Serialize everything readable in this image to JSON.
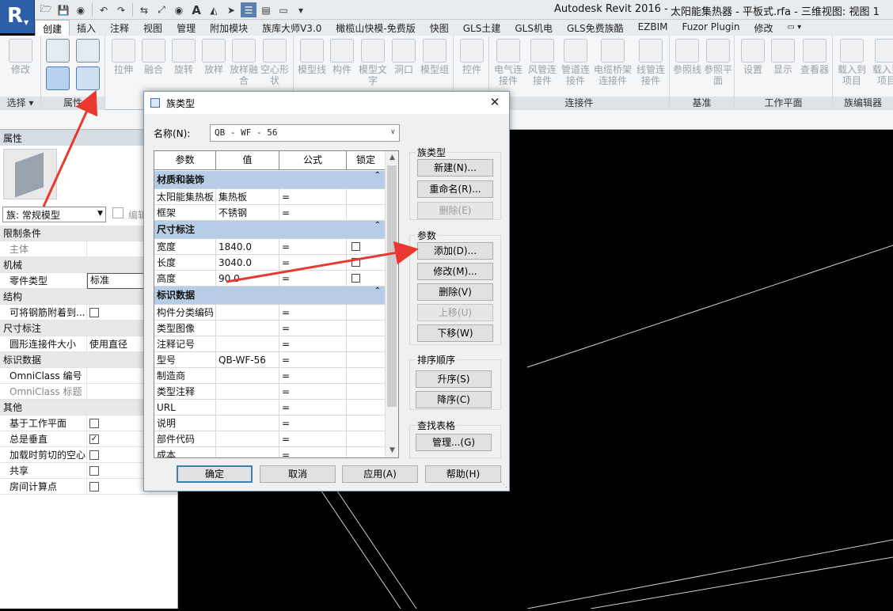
{
  "app": {
    "logo_letter": "R",
    "title": "Autodesk Revit 2016 -",
    "document": "太阳能集热器 - 平板式.rfa - 三维视图: 视图 1"
  },
  "ribbon_tabs": [
    "创建",
    "插入",
    "注释",
    "视图",
    "管理",
    "附加模块",
    "族库大师V3.0",
    "橄榄山快模-免费版",
    "快图",
    "GLS土建",
    "GLS机电",
    "GLS免费族酷",
    "EZBIM",
    "Fuzor Plugin",
    "修改"
  ],
  "ribbon": {
    "select": {
      "title": "选择",
      "modify": "修改"
    },
    "properties": {
      "title": "属性"
    },
    "forms": [
      "拉伸",
      "融合",
      "旋转",
      "放样",
      "放样融合",
      "空心形状"
    ],
    "model": [
      "模型线",
      "构件",
      "模型文字",
      "洞口",
      "模型组"
    ],
    "control": [
      "控件"
    ],
    "connectors": {
      "title": "连接件",
      "items": [
        "电气连接件",
        "风管连接件",
        "管道连接件",
        "电缆桥架连接件",
        "线管连接件"
      ]
    },
    "datum": {
      "title": "基准",
      "items": [
        "参照线",
        "参照平面"
      ]
    },
    "workplane": {
      "title": "工作平面",
      "items": [
        "设置",
        "显示",
        "查看器"
      ]
    },
    "family_editor": {
      "title": "族编辑器",
      "items": [
        "载入到项目",
        "载入到项目"
      ]
    }
  },
  "properties": {
    "header": "属性",
    "family_select": "族: 常规模型",
    "edit_type": "编辑",
    "rows": [
      {
        "type": "group",
        "label": "限制条件"
      },
      {
        "type": "prop",
        "name": "主体",
        "value": "",
        "dim": true
      },
      {
        "type": "group",
        "label": "机械"
      },
      {
        "type": "prop",
        "name": "零件类型",
        "value": "标准",
        "boxed": true
      },
      {
        "type": "group",
        "label": "结构"
      },
      {
        "type": "prop",
        "name": "可将钢筋附着到...",
        "check": false
      },
      {
        "type": "group",
        "label": "尺寸标注"
      },
      {
        "type": "prop",
        "name": "圆形连接件大小",
        "value": "使用直径"
      },
      {
        "type": "group",
        "label": "标识数据"
      },
      {
        "type": "prop",
        "name": "OmniClass 编号",
        "value": ""
      },
      {
        "type": "prop",
        "name": "OmniClass 标题",
        "value": "",
        "dim": true
      },
      {
        "type": "group",
        "label": "其他"
      },
      {
        "type": "prop",
        "name": "基于工作平面",
        "check": false
      },
      {
        "type": "prop",
        "name": "总是垂直",
        "check": true
      },
      {
        "type": "prop",
        "name": "加载时剪切的空心",
        "check": false
      },
      {
        "type": "prop",
        "name": "共享",
        "check": false
      },
      {
        "type": "prop",
        "name": "房间计算点",
        "check": false
      }
    ]
  },
  "dialog": {
    "title": "族类型",
    "name_label": "名称(N):",
    "name_value": "QB - WF - 56",
    "columns": [
      "参数",
      "值",
      "公式",
      "锁定"
    ],
    "rows": [
      {
        "type": "group",
        "label": "材质和装饰"
      },
      {
        "type": "row",
        "param": "太阳能集热板",
        "value": "集热板",
        "formula": "=",
        "lock": false
      },
      {
        "type": "row",
        "param": "框架",
        "value": "不锈钢",
        "formula": "=",
        "lock": false
      },
      {
        "type": "group",
        "label": "尺寸标注"
      },
      {
        "type": "row",
        "param": "宽度",
        "value": "1840.0",
        "formula": "=",
        "lock": true
      },
      {
        "type": "row",
        "param": "长度",
        "value": "3040.0",
        "formula": "=",
        "lock": true
      },
      {
        "type": "row",
        "param": "高度",
        "value": "90.0",
        "formula": "=",
        "lock": true
      },
      {
        "type": "group",
        "label": "标识数据"
      },
      {
        "type": "row",
        "param": "构件分类编码",
        "value": "",
        "formula": "=",
        "lock": false
      },
      {
        "type": "row",
        "param": "类型图像",
        "value": "",
        "formula": "=",
        "lock": false
      },
      {
        "type": "row",
        "param": "注释记号",
        "value": "",
        "formula": "=",
        "lock": false
      },
      {
        "type": "row",
        "param": "型号",
        "value": "QB-WF-56",
        "formula": "=",
        "lock": false
      },
      {
        "type": "row",
        "param": "制造商",
        "value": "",
        "formula": "=",
        "lock": false
      },
      {
        "type": "row",
        "param": "类型注释",
        "value": "",
        "formula": "=",
        "lock": false
      },
      {
        "type": "row",
        "param": "URL",
        "value": "",
        "formula": "=",
        "lock": false
      },
      {
        "type": "row",
        "param": "说明",
        "value": "",
        "formula": "=",
        "lock": false
      },
      {
        "type": "row",
        "param": "部件代码",
        "value": "",
        "formula": "=",
        "lock": false
      },
      {
        "type": "row",
        "param": "成本",
        "value": "",
        "formula": "=",
        "lock": false
      }
    ],
    "family_types_group": "族类型",
    "btn_new": "新建(N)...",
    "btn_rename": "重命名(R)...",
    "btn_delete_type": "删除(E)",
    "params_group": "参数",
    "btn_add": "添加(D)...",
    "btn_modify": "修改(M)...",
    "btn_delete_param": "删除(V)",
    "btn_up": "上移(U)",
    "btn_down": "下移(W)",
    "sort_group": "排序顺序",
    "btn_asc": "升序(S)",
    "btn_desc": "降序(C)",
    "lookup_group": "查找表格",
    "btn_manage": "管理...(G)",
    "btn_ok": "确定",
    "btn_cancel": "取消",
    "btn_apply": "应用(A)",
    "btn_help": "帮助(H)"
  },
  "colors": {
    "annotation": "#e8382f",
    "canvas": "#000000",
    "group_row": "#b7cde6"
  }
}
